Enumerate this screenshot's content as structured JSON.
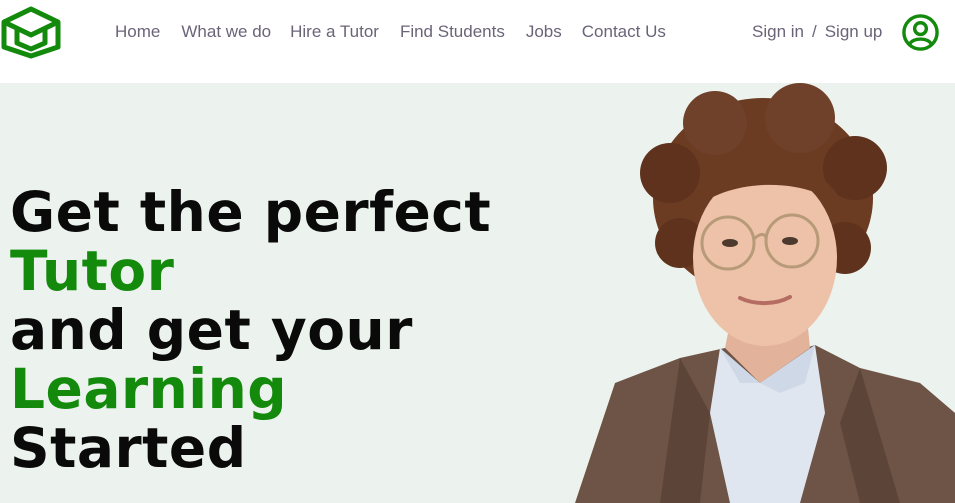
{
  "brand": {
    "logo_icon": "graduation-cap-icon",
    "accent_color": "#138a0c"
  },
  "nav": {
    "items": [
      {
        "label": "Home"
      },
      {
        "label": "What we do"
      },
      {
        "label": "Hire a Tutor"
      },
      {
        "label": "Find Students"
      },
      {
        "label": "Jobs"
      },
      {
        "label": "Contact Us"
      }
    ]
  },
  "auth": {
    "sign_in": "Sign in",
    "separator": "/",
    "sign_up": "Sign up",
    "user_icon": "user-circle-icon"
  },
  "hero": {
    "line1": "Get the perfect",
    "line2": "Tutor",
    "line3": "and get your",
    "line4": "Learning",
    "line5": "Started",
    "background": "#ecf3ee",
    "image": "tutor-portrait"
  }
}
